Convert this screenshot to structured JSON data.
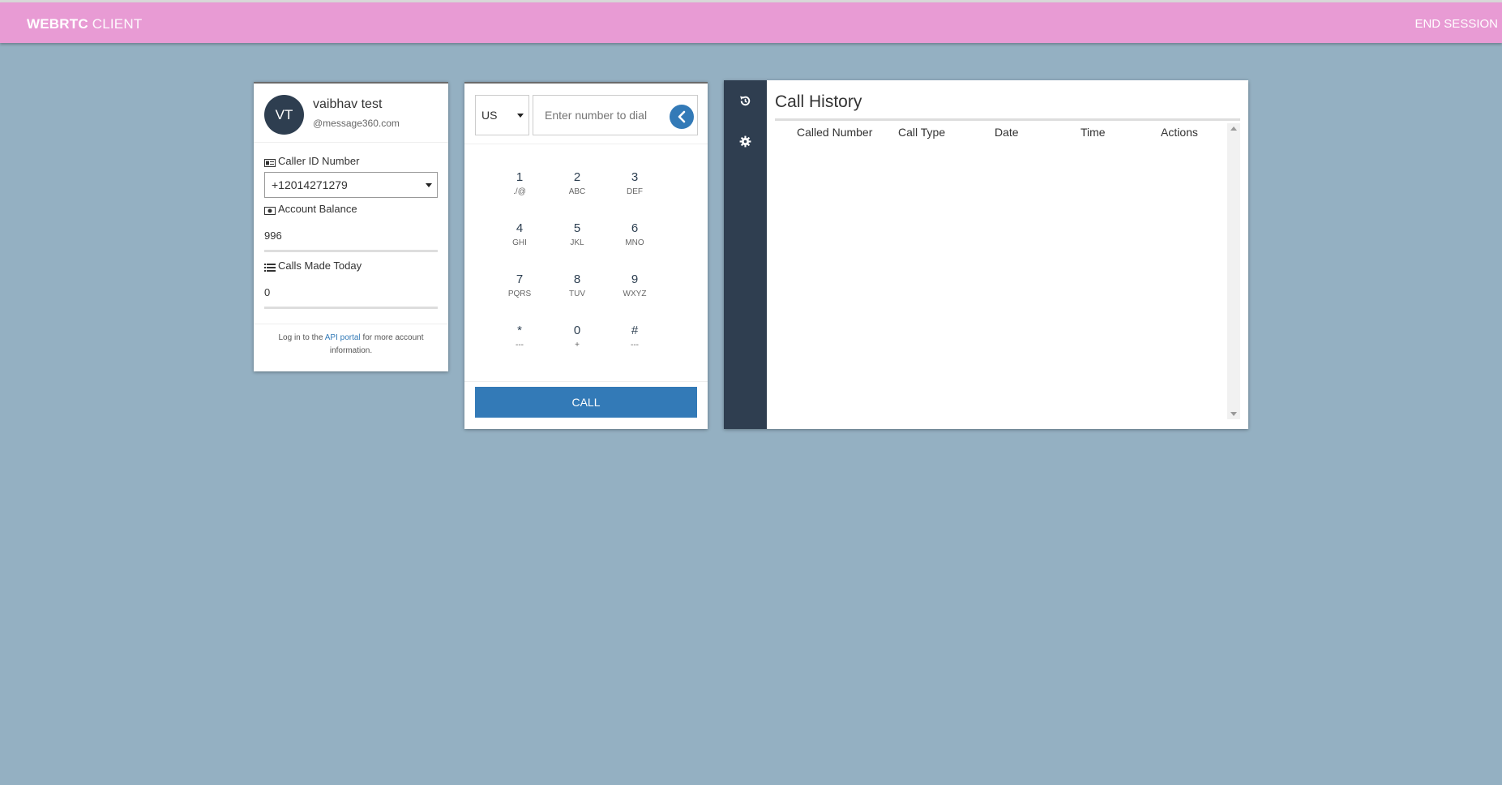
{
  "navbar": {
    "brand_bold": "WEBRTC",
    "brand_thin": "CLIENT",
    "end_session": "END SESSION",
    "background": "#e89bd4"
  },
  "profile": {
    "initials": "VT",
    "name": "vaibhav test",
    "domain": "@message360.com",
    "caller_id_label": "Caller ID Number",
    "caller_id_value": "+12014271279",
    "balance_label": "Account Balance",
    "balance_value": "996",
    "calls_label": "Calls Made Today",
    "calls_value": "0",
    "footer_before": "Log in to the ",
    "footer_link": "API portal",
    "footer_after": " for more account information."
  },
  "dialer": {
    "country": "US",
    "placeholder": "Enter number to dial",
    "keys": [
      {
        "digit": "1",
        "letters": "./@"
      },
      {
        "digit": "2",
        "letters": "ABC"
      },
      {
        "digit": "3",
        "letters": "DEF"
      },
      {
        "digit": "4",
        "letters": "GHI"
      },
      {
        "digit": "5",
        "letters": "JKL"
      },
      {
        "digit": "6",
        "letters": "MNO"
      },
      {
        "digit": "7",
        "letters": "PQRS"
      },
      {
        "digit": "8",
        "letters": "TUV"
      },
      {
        "digit": "9",
        "letters": "WXYZ"
      },
      {
        "digit": "*",
        "letters": "---"
      },
      {
        "digit": "0",
        "letters": "+"
      },
      {
        "digit": "#",
        "letters": "---"
      }
    ],
    "call_label": "CALL",
    "accent": "#337ab7"
  },
  "history": {
    "nav_icons": [
      "history-icon",
      "gear-icon"
    ],
    "title": "Call History",
    "columns": [
      "Called Number",
      "Call Type",
      "Date",
      "Time",
      "Actions"
    ],
    "rows": []
  },
  "colors": {
    "page_background": "#94b0c2",
    "sidebar": "#2f3e50"
  }
}
